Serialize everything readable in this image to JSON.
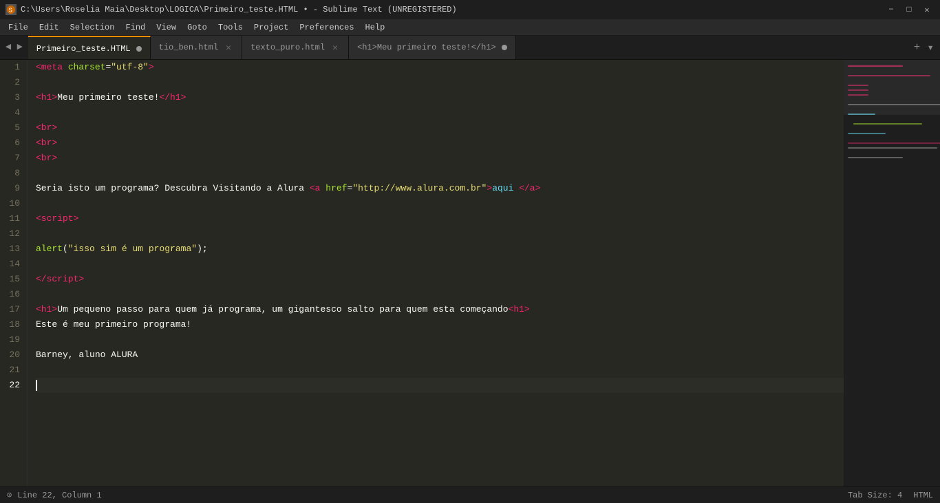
{
  "titlebar": {
    "path": "C:\\Users\\Roselia Maia\\Desktop\\LOGICA\\Primeiro_teste.HTML",
    "app": "Sublime Text (UNREGISTERED)",
    "full": "C:\\Users\\Roselia Maia\\Desktop\\LOGICA\\Primeiro_teste.HTML • - Sublime Text (UNREGISTERED)"
  },
  "menubar": {
    "items": [
      "File",
      "Edit",
      "Selection",
      "Find",
      "View",
      "Goto",
      "Tools",
      "Project",
      "Preferences",
      "Help"
    ]
  },
  "tabs": [
    {
      "label": "Primeiro_teste.HTML",
      "active": true,
      "dirty": true,
      "close": false
    },
    {
      "label": "tio_ben.html",
      "active": false,
      "dirty": false,
      "close": true
    },
    {
      "label": "texto_puro.html",
      "active": false,
      "dirty": false,
      "close": true
    },
    {
      "label": "<h1>Meu primeiro teste!</h1>",
      "active": false,
      "dirty": true,
      "close": false
    }
  ],
  "statusbar": {
    "left": {
      "icon": "⊙",
      "position": "Line 22, Column 1"
    },
    "right": {
      "tab_size": "Tab Size: 4",
      "syntax": "HTML"
    }
  },
  "lines": [
    {
      "num": 1,
      "content": ""
    },
    {
      "num": 2,
      "content": ""
    },
    {
      "num": 3,
      "content": ""
    },
    {
      "num": 4,
      "content": ""
    },
    {
      "num": 5,
      "content": ""
    },
    {
      "num": 6,
      "content": ""
    },
    {
      "num": 7,
      "content": ""
    },
    {
      "num": 8,
      "content": ""
    },
    {
      "num": 9,
      "content": ""
    },
    {
      "num": 10,
      "content": ""
    },
    {
      "num": 11,
      "content": ""
    },
    {
      "num": 12,
      "content": ""
    },
    {
      "num": 13,
      "content": ""
    },
    {
      "num": 14,
      "content": ""
    },
    {
      "num": 15,
      "content": ""
    },
    {
      "num": 16,
      "content": ""
    },
    {
      "num": 17,
      "content": ""
    },
    {
      "num": 18,
      "content": ""
    },
    {
      "num": 19,
      "content": ""
    },
    {
      "num": 20,
      "content": ""
    },
    {
      "num": 21,
      "content": ""
    },
    {
      "num": 22,
      "content": ""
    }
  ]
}
